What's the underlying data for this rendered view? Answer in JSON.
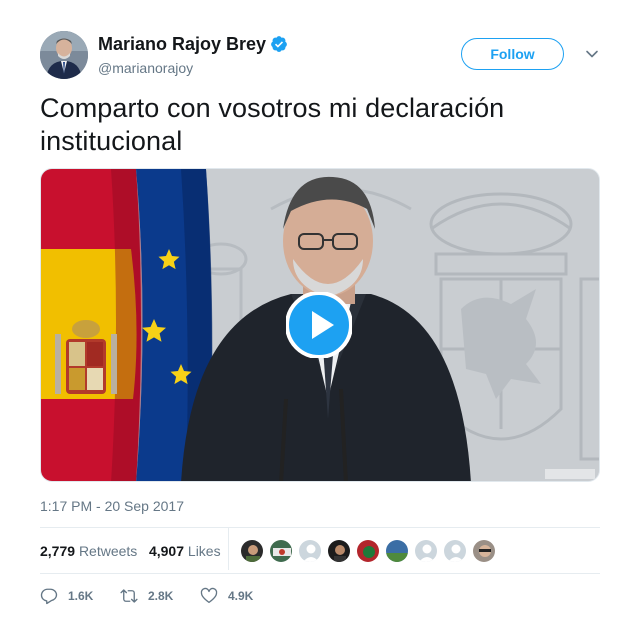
{
  "author": {
    "name": "Mariano Rajoy Brey",
    "handle": "@marianorajoy",
    "verified_color": "#1da1f2"
  },
  "follow_button": {
    "label": "Follow"
  },
  "caret_icon": "chevron-down-icon",
  "tweet": {
    "text": "Comparto con vosotros mi declaración institucional",
    "timestamp": "1:17 PM - 20 Sep 2017"
  },
  "media": {
    "type": "video",
    "play_icon": "play-icon"
  },
  "stats": {
    "retweets_count": "2,779",
    "retweets_label": "Retweets",
    "likes_count": "4,907",
    "likes_label": "Likes"
  },
  "actions": {
    "reply_count": "1.6K",
    "retweet_count": "2.8K",
    "like_count": "4.9K"
  },
  "colors": {
    "accent": "#1da1f2",
    "text": "#14171a",
    "muted": "#657786",
    "border": "#e6ecf0"
  }
}
